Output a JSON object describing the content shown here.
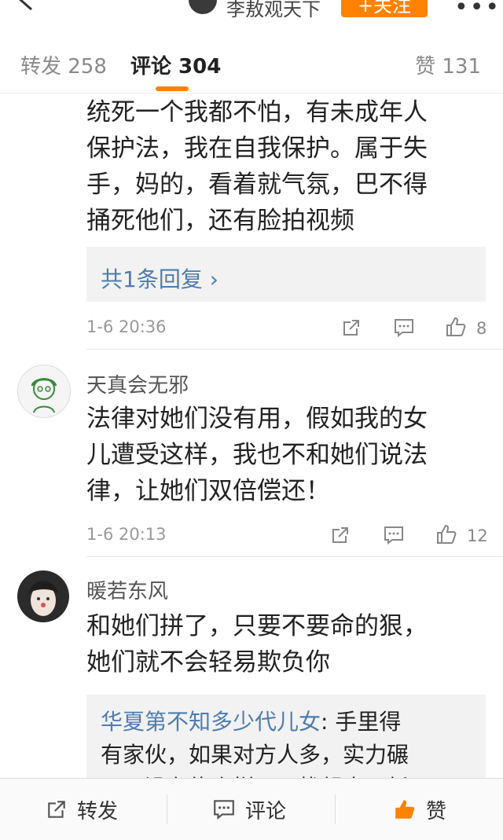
{
  "topnav": {
    "title": "李敖观天下",
    "follow_label": "+关注"
  },
  "tabs": {
    "repost": "转发 258",
    "comment": "评论 304",
    "like": "赞 131"
  },
  "comments": [
    {
      "text": "统死一个我都不怕，有未成年人保护法，我在自我保护。属于失手，妈的，看着就气氛，巴不得捅死他们，还有脸拍视频",
      "lines": [
        "统死一个我都不怕，有未成年人",
        "保护法，我在自我保护。属于失",
        "手，妈的，看着就气氛，巴不得",
        "捅死他们，还有脸拍视频"
      ],
      "reply_link": "共1条回复 ›",
      "time": "1-6 20:36",
      "likes": "8"
    },
    {
      "user": "天真会无邪",
      "lines": [
        "法律对她们没有用，假如我的女",
        "儿遭受这样，我也不和她们说法",
        "律，让她们双倍偿还！"
      ],
      "time": "1-6 20:13",
      "likes": "12"
    },
    {
      "user": "暖若东风",
      "lines": [
        "和她们拼了，只要不要命的狠，",
        "她们就不会轻易欺负你"
      ],
      "reply_user": "华夏第不知多少代儿女",
      "reply_lines": [
        ": 手里得",
        "有家伙，如果对方人多，实力碾",
        "压，没有绝小样下风找起来，新"
      ]
    }
  ],
  "bottombar": {
    "repost": "转发",
    "comment": "评论",
    "like": "赞"
  },
  "colors": {
    "accent": "#ff8200",
    "link": "#4f7cae"
  }
}
